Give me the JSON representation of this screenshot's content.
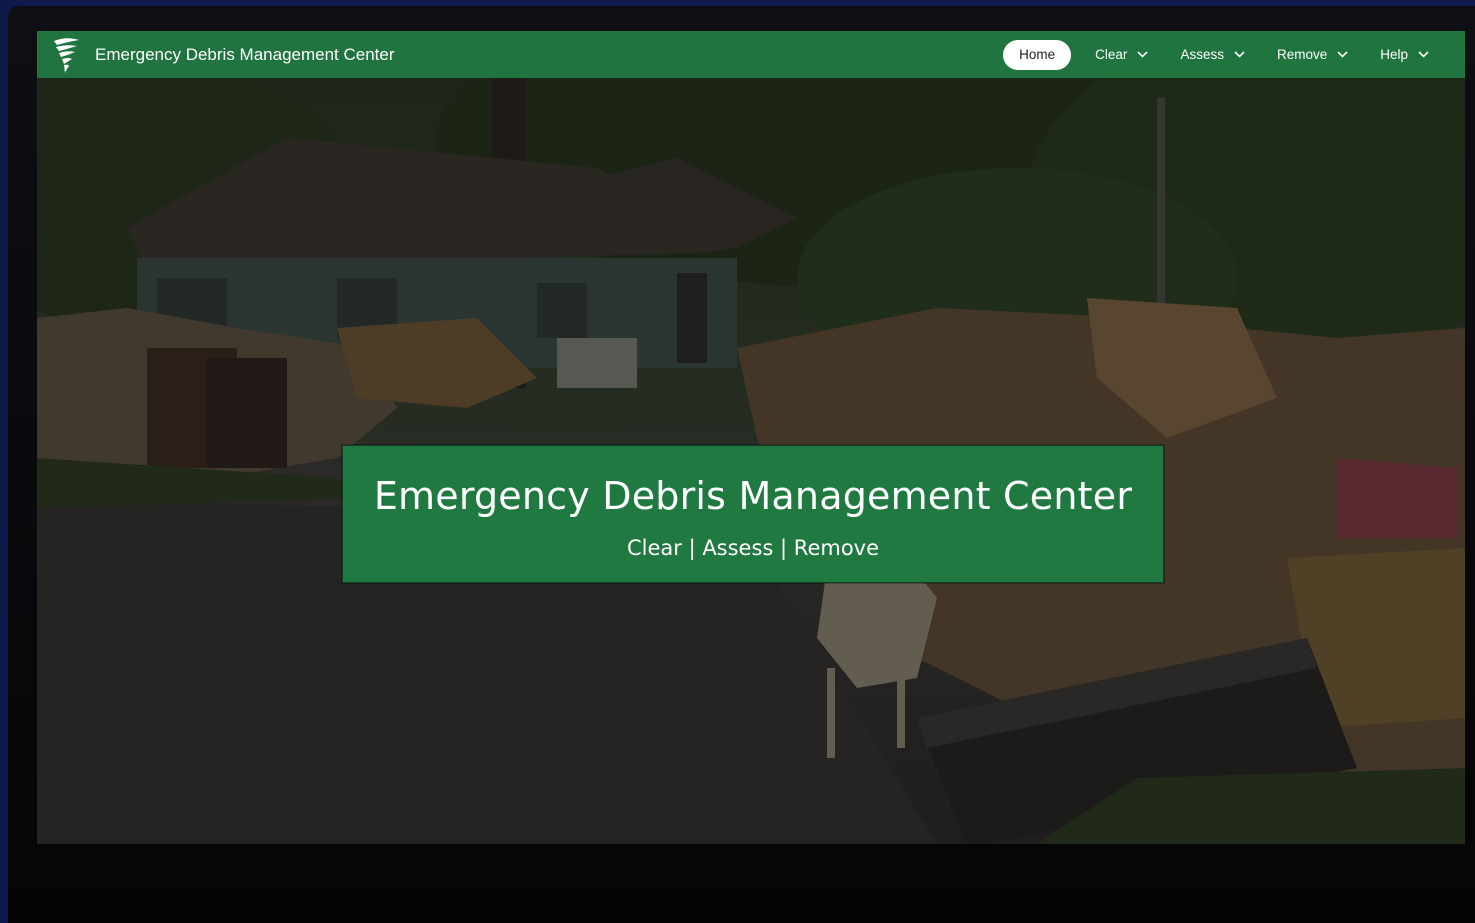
{
  "app": {
    "title": "Emergency Debris Management Center",
    "logo_icon": "tornado-icon"
  },
  "nav": {
    "home": "Home",
    "items": [
      {
        "label": "Clear",
        "icon": "chevron-down-icon"
      },
      {
        "label": "Assess",
        "icon": "chevron-down-icon"
      },
      {
        "label": "Remove",
        "icon": "chevron-down-icon"
      },
      {
        "label": "Help",
        "icon": "chevron-down-icon"
      }
    ]
  },
  "banner": {
    "title": "Emergency Debris Management Center",
    "subtitle": "Clear | Assess | Remove"
  },
  "colors": {
    "brand_green": "#207440",
    "page_bg": "#0d1a4a"
  }
}
